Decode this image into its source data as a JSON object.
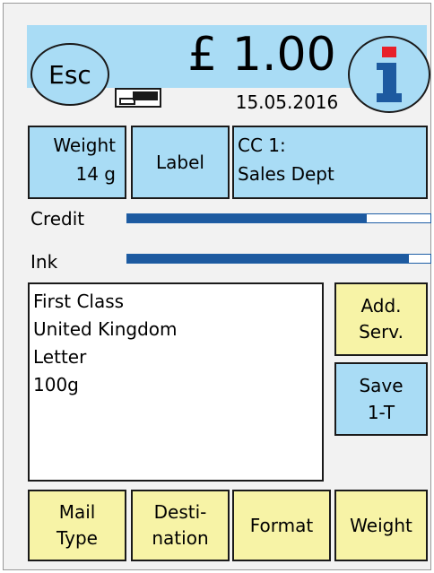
{
  "header": {
    "esc_label": "Esc",
    "price": "£ 1.00",
    "date": "15.05.2016"
  },
  "top_buttons": {
    "weight_line1": "Weight",
    "weight_line2": "14 g",
    "label": "Label",
    "cost_center_line1": "CC 1:",
    "cost_center_line2": "Sales Dept"
  },
  "meters": {
    "credit_label": "Credit",
    "credit_level": 0.79,
    "ink_label": "Ink",
    "ink_level": 0.93
  },
  "service": {
    "lines": [
      "First Class",
      "United Kingdom",
      "Letter",
      "100g"
    ]
  },
  "side_buttons": {
    "add_serv_line1": "Add.",
    "add_serv_line2": "Serv.",
    "save_line1": "Save",
    "save_line2": "1-T"
  },
  "bottom_buttons": {
    "mail_type_line1": "Mail",
    "mail_type_line2": "Type",
    "destination_line1": "Desti-",
    "destination_line2": "nation",
    "format": "Format",
    "weight": "Weight"
  },
  "colors": {
    "header_blue": "#a9dcf5",
    "button_yellow": "#f7f3a6",
    "meter_blue": "#1d5aa0",
    "info_red": "#e8202a"
  },
  "icons": {
    "info": "info-icon",
    "ink_status": "ink-cartridge-icon"
  }
}
